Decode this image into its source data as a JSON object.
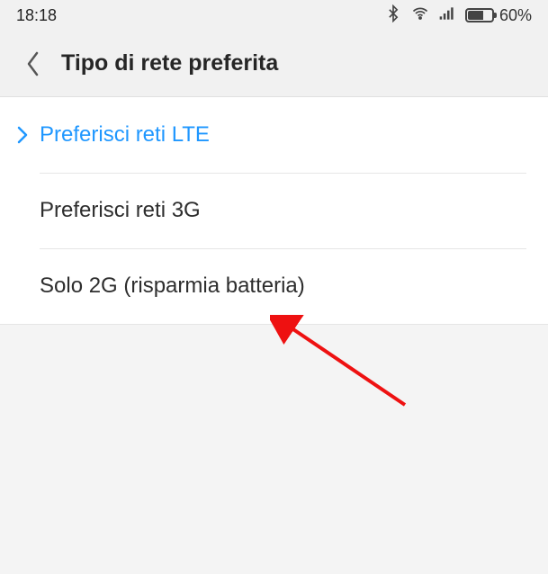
{
  "statusbar": {
    "time": "18:18",
    "battery_label": "60%"
  },
  "header": {
    "title": "Tipo di rete preferita"
  },
  "network_options": {
    "items": [
      {
        "label": "Preferisci reti LTE",
        "selected": true
      },
      {
        "label": "Preferisci reti 3G",
        "selected": false
      },
      {
        "label": "Solo 2G (risparmia batteria)",
        "selected": false
      }
    ]
  },
  "annotation": {
    "target_index": 2
  }
}
